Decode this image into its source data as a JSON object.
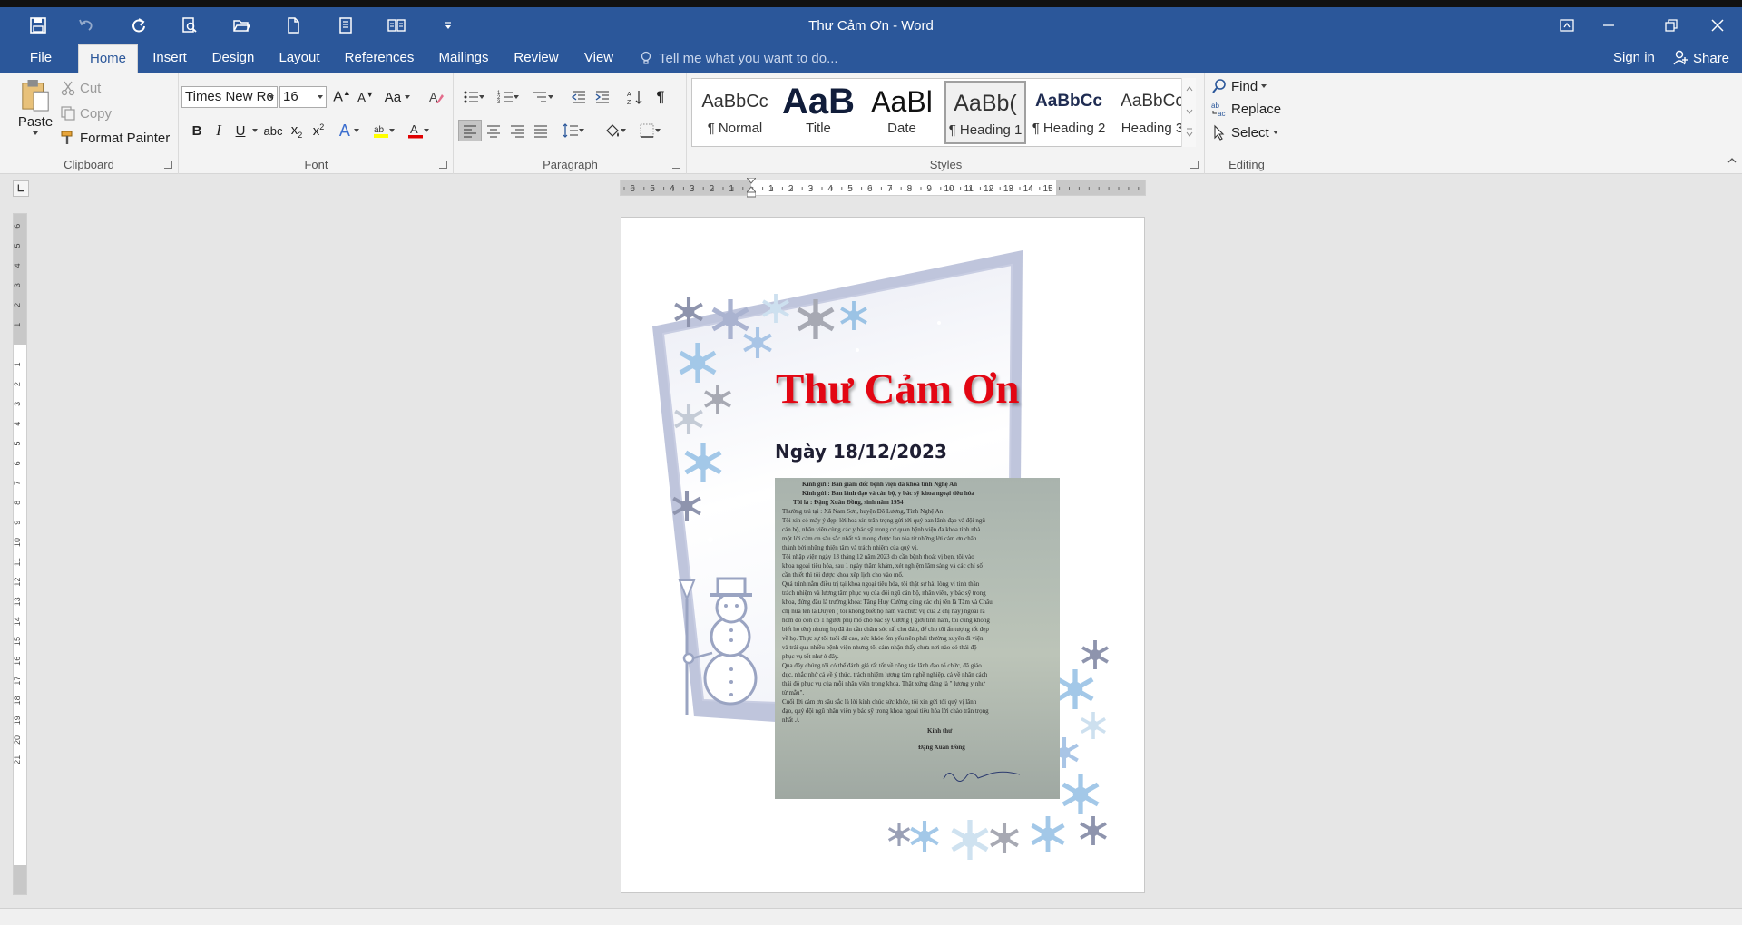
{
  "window": {
    "title": "Thư Cảm Ơn - Word",
    "quick_access": [
      "save-icon",
      "undo-icon",
      "redo-icon",
      "print-preview-icon",
      "open-icon",
      "new-document-icon",
      "document-icon",
      "read-mode-icon",
      "customize-icon"
    ]
  },
  "tabs": [
    "File",
    "Home",
    "Insert",
    "Design",
    "Layout",
    "References",
    "Mailings",
    "Review",
    "View"
  ],
  "active_tab": "Home",
  "tell_me": "Tell me what you want to do...",
  "account": {
    "sign_in": "Sign in",
    "share": "Share"
  },
  "clipboard": {
    "paste": "Paste",
    "cut": "Cut",
    "copy": "Copy",
    "format_painter": "Format Painter",
    "group": "Clipboard"
  },
  "font": {
    "name": "Times New Ro",
    "size": "16",
    "change_case": "Aa",
    "group": "Font",
    "bold": "B",
    "italic": "I",
    "underline": "U",
    "strike": "abc",
    "highlight_color": "#ffff00",
    "font_color": "#e00000"
  },
  "paragraph": {
    "group": "Paragraph"
  },
  "styles": {
    "group": "Styles",
    "items": [
      {
        "preview": "AaBbCc",
        "name": "¶ Normal"
      },
      {
        "preview": "AaB",
        "name": "Title"
      },
      {
        "preview": "AaBl",
        "name": "Date"
      },
      {
        "preview": "AaBb(",
        "name": "¶ Heading 1"
      },
      {
        "preview": "AaBbCc",
        "name": "¶ Heading 2"
      },
      {
        "preview": "AaBbCc",
        "name": "Heading 3"
      }
    ],
    "selected_index": 3
  },
  "editing": {
    "find": "Find",
    "replace": "Replace",
    "select": "Select",
    "group": "Editing"
  },
  "ruler": {
    "numbers": [
      "6",
      "5",
      "4",
      "3",
      "2",
      "1",
      "1",
      "2",
      "3",
      "4",
      "5",
      "6",
      "7",
      "8",
      "9",
      "10",
      "11",
      "12",
      "13",
      "14",
      "15"
    ]
  },
  "document": {
    "heading": "Thư Cảm Ơn",
    "date": "Ngày 18/12/2023",
    "heading_color": "#e30613",
    "letter_lines": [
      "Kính gửi : Ban giám đốc bệnh viện đa khoa tỉnh Nghệ An",
      "Kính gửi : Ban lãnh đạo và cán bộ, y bác sỹ khoa ngoại tiêu hóa",
      "Tôi là : Đặng Xuân Đồng, sinh năm 1954",
      "Thường trú tại : Xã Nam Sơn, huyện Đô Lương, Tỉnh Nghệ An",
      "Tôi xin có mấy ý đẹp, lời hoa xin trân trọng gửi tới quý ban lãnh đạo và đội ngũ",
      "cán bộ, nhân viên cùng các y bác sỹ trong cơ quan bệnh viện đa khoa tỉnh nhà",
      "một lời cảm ơn sâu sắc nhất và mong được lan tỏa từ những lời cảm ơn chân",
      "thành bởi những thiện tâm và trách nhiệm của quý vị.",
      "Tôi nhập viện ngày 13 tháng 12 năm 2023 do cần bệnh thoát vị bẹn, tôi vào",
      "khoa ngoại tiêu hóa, sau 1 ngày thăm khám, xét nghiệm lâm sàng và các chỉ số",
      "cần thiết thì tôi được khoa xếp lịch cho vào mổ.",
      "Quá trình nằm điều trị tại khoa ngoại tiêu hóa, tôi thật sự hài lòng vì tinh thần",
      "trách nhiệm và lương tâm phục vụ của đội ngũ cán bộ, nhân viên, y bác sỹ trong",
      "khoa, đứng đầu là trưởng khoa: Tăng Huy Cường cùng các chị tên là Tâm và Châu",
      "chị nữa tên là Duyên ( tôi không biết họ hàm và chức vụ của 2 chị này) ngoài ra",
      "hôm đó còn có 1 người phụ mổ cho bác sỹ Cường ( giới tính nam, tôi cũng không",
      "biết họ tên) nhưng họ đã ân cần chăm sóc rất chu đáo, để cho tôi ấn tượng tốt đẹp",
      "về họ. Thực sự tôi tuổi đã cao, sức khỏe ốm yếu nên phải thường xuyên đi viện",
      "và trải qua nhiều bệnh viện nhưng tôi cảm nhận thấy chưa nơi nào có thái độ",
      "phục vụ tốt như ở đây.",
      "Qua đây chúng tôi có thể đánh giá rất tốt về công tác lãnh đạo tổ chức, đã giáo",
      "dục, nhắc nhở cả về ý thức, trách nhiệm lương tâm nghề nghiệp, cả về nhân cách",
      "thái độ phục vụ của mỗi nhân viên trong khoa. Thật xứng đáng là \" lương y như",
      "từ mẫu\".",
      "Cuối lời cảm ơn sâu sắc là lời kính chúc sức khỏe, tôi xin gửi tới quý vị lãnh",
      "đạo, quý đội ngũ nhân viên y bác sỹ trong khoa ngoại tiêu hóa lời chào trân trọng",
      "nhất ./.",
      "Kính thư",
      "Đặng Xuân Đồng"
    ]
  }
}
